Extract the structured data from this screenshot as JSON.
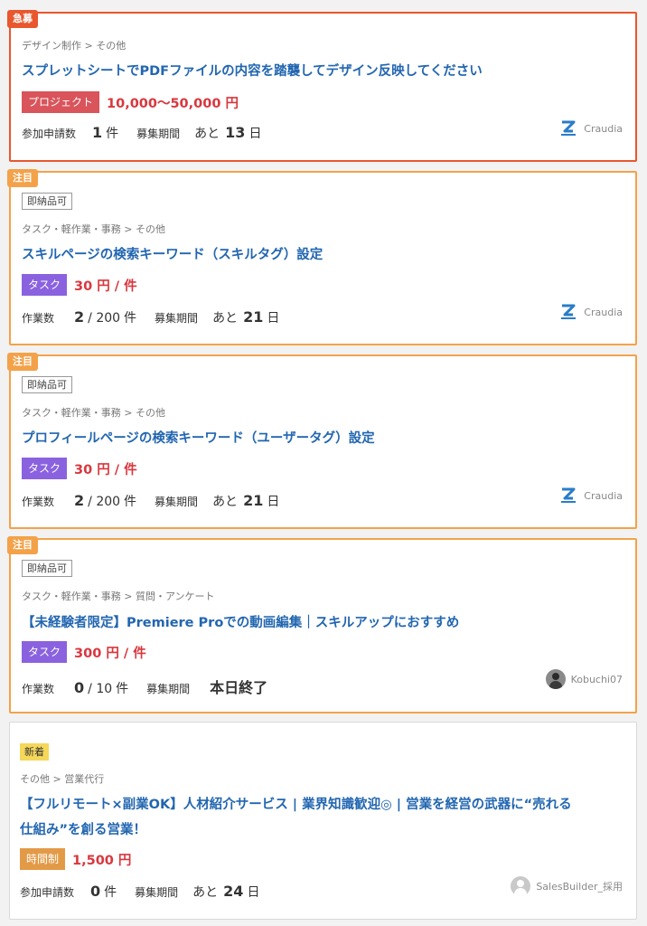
{
  "labels": {
    "urgent": "急募",
    "featured": "注目",
    "new": "新着",
    "instant": "即納品可",
    "applicants": "参加申請数",
    "work_count": "作業数",
    "period": "募集期間",
    "remain_prefix": "あと",
    "days_unit": "日",
    "count_unit": "件"
  },
  "cards": [
    {
      "category": "デザイン制作 > その他",
      "title": "スプレットシートでPDFファイルの内容を踏襲してデザイン反映してください",
      "type": "プロジェクト",
      "price": "10,000〜50,000 円",
      "count": "1",
      "days": "13",
      "owner": "Craudia"
    },
    {
      "category": "タスク・軽作業・事務 > その他",
      "title": "スキルページの検索キーワード（スキルタグ）設定",
      "type": "タスク",
      "price": "30 円 / 件",
      "done": "2",
      "total": "/ 200",
      "days": "21",
      "owner": "Craudia"
    },
    {
      "category": "タスク・軽作業・事務 > その他",
      "title": "プロフィールページの検索キーワード（ユーザータグ）設定",
      "type": "タスク",
      "price": "30 円 / 件",
      "done": "2",
      "total": "/ 200",
      "days": "21",
      "owner": "Craudia"
    },
    {
      "category": "タスク・軽作業・事務 > 質問・アンケート",
      "title": "【未経験者限定】Premiere Proでの動画編集｜スキルアップにおすすめ",
      "type": "タスク",
      "price": "300 円 / 件",
      "done": "0",
      "total": "/ 10",
      "status": "本日終了",
      "owner": "Kobuchi07"
    },
    {
      "category": "その他 > 営業代行",
      "title": "【フルリモート×副業OK】人材紹介サービス | 業界知識歓迎◎ | 営業を経営の武器に“売れる仕組み”を創る営業！",
      "type": "時間制",
      "price": "1,500 円",
      "count": "0",
      "days": "24",
      "owner": "SalesBuilder_採用"
    }
  ],
  "colors": {
    "urgent": "#e8572e",
    "featured": "#f3a24a",
    "title": "#2266b0",
    "price": "#d9373e",
    "project": "#d9545b",
    "task": "#8a62df",
    "hourly": "#e39a47",
    "new_badge": "#f5d75a"
  },
  "icons": {
    "craudia_logo": "craudia-logo-icon",
    "avatar": "user-avatar-icon"
  }
}
